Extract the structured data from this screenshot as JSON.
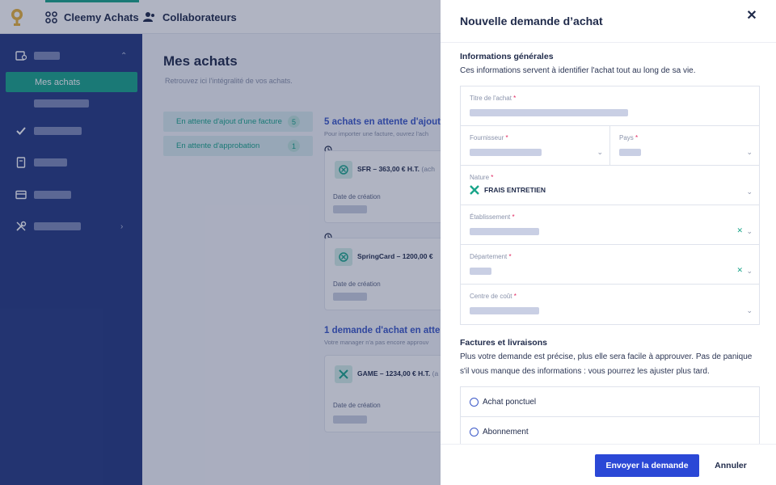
{
  "topbar": {
    "nav": [
      {
        "label": "Cleemy Achats",
        "icon": "grid-icon",
        "active": true
      },
      {
        "label": "Collaborateurs",
        "icon": "users-icon",
        "active": false
      }
    ]
  },
  "sidebar": {
    "active_item": "Mes achats",
    "items": [
      {
        "icon": "wallet-icon"
      },
      {
        "icon": "check-icon"
      },
      {
        "icon": "document-icon"
      },
      {
        "icon": "card-icon"
      },
      {
        "icon": "tools-icon"
      }
    ]
  },
  "main": {
    "title": "Mes achats",
    "subtitle": "Retrouvez ici l'intégralité de vos achats.",
    "filters": [
      {
        "label": "En attente d'ajout d'une facture",
        "count": "5"
      },
      {
        "label": "En attente d'approbation",
        "count": "1"
      }
    ],
    "section1": {
      "title": "5 achats en attente d'ajout d",
      "subtitle": "Pour importer une facture, ouvrez l'ach",
      "cards": [
        {
          "title": "SFR – 363,00 € H.T.",
          "suffix": "(ach",
          "date_label": "Date de création"
        },
        {
          "title": "SpringCard – 1200,00 €",
          "suffix": "",
          "date_label": "Date de création"
        }
      ]
    },
    "section2": {
      "title": "1 demande d'achat en atten",
      "subtitle": "Votre manager n'a pas encore approuv",
      "cards": [
        {
          "title": "GAME – 1234,00 € H.T.",
          "suffix": "(a",
          "date_label": "Date de création"
        }
      ]
    }
  },
  "drawer": {
    "title": "Nouvelle demande d’achat",
    "close_icon": "close-icon",
    "general": {
      "heading": "Informations générales",
      "text": "Ces informations servent à identifier l'achat tout au long de sa vie."
    },
    "fields": {
      "titre": {
        "label": "Titre de l'achat"
      },
      "fournisseur": {
        "label": "Fournisseur"
      },
      "pays": {
        "label": "Pays"
      },
      "nature": {
        "label": "Nature",
        "value": "FRAIS ENTRETIEN"
      },
      "etablissement": {
        "label": "Établissement"
      },
      "departement": {
        "label": "Département"
      },
      "centre": {
        "label": "Centre de coût"
      }
    },
    "required_mark": "*",
    "factures": {
      "heading": "Factures et livraisons",
      "text": "Plus votre demande est précise, plus elle sera facile à approuver. Pas de panique s'il vous manque des informations : vous pourrez les ajuster plus tard."
    },
    "options": [
      {
        "label": "Achat ponctuel"
      },
      {
        "label": "Abonnement"
      }
    ],
    "buttons": {
      "submit": "Envoyer la demande",
      "cancel": "Annuler"
    }
  },
  "colors": {
    "accent": "#1aa58a",
    "primary": "#2b48d6",
    "sidebar": "#263a82"
  }
}
